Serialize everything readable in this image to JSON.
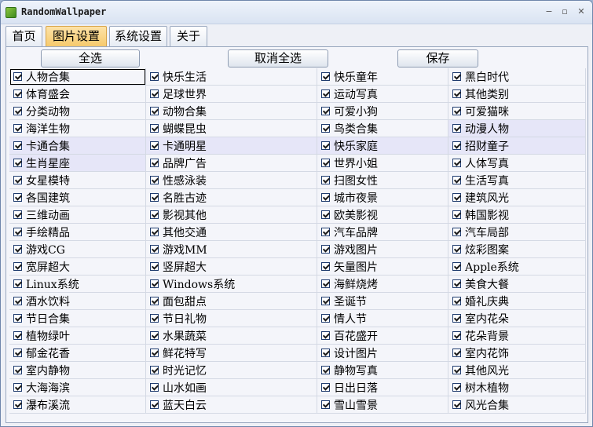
{
  "window": {
    "title": "RandomWallpaper"
  },
  "title_controls": {
    "minimize": "−",
    "maximize": "▫",
    "close": "✕"
  },
  "tabs": [
    {
      "label": "首页"
    },
    {
      "label": "图片设置"
    },
    {
      "label": "系统设置"
    },
    {
      "label": "关于"
    }
  ],
  "toolbar": {
    "select_all": "全选",
    "deselect_all": "取消全选",
    "save": "保存"
  },
  "categories": [
    [
      "人物合集",
      "快乐生活",
      "快乐童年",
      "黑白时代"
    ],
    [
      "体育盛会",
      "足球世界",
      "运动写真",
      "其他类别"
    ],
    [
      "分类动物",
      "动物合集",
      "可爱小狗",
      "可爱猫咪"
    ],
    [
      "海洋生物",
      "蝴蝶昆虫",
      "鸟类合集",
      "动漫人物"
    ],
    [
      "卡通合集",
      "卡通明星",
      "快乐家庭",
      "招财童子"
    ],
    [
      "生肖星座",
      "品牌广告",
      "世界小姐",
      "人体写真"
    ],
    [
      "女星模特",
      "性感泳装",
      "扫图女性",
      "生活写真"
    ],
    [
      "各国建筑",
      "名胜古迹",
      "城市夜景",
      "建筑风光"
    ],
    [
      "三维动画",
      "影视其他",
      "欧美影视",
      "韩国影视"
    ],
    [
      "手绘精品",
      "其他交通",
      "汽车品牌",
      "汽车局部"
    ],
    [
      "游戏CG",
      "游戏MM",
      "游戏图片",
      "炫彩图案"
    ],
    [
      "宽屏超大",
      "竖屏超大",
      "矢量图片",
      "Apple系统"
    ],
    [
      "Linux系统",
      "Windows系统",
      "海鲜烧烤",
      "美食大餐"
    ],
    [
      "酒水饮料",
      "面包甜点",
      "圣诞节",
      "婚礼庆典"
    ],
    [
      "节日合集",
      "节日礼物",
      "情人节",
      "室内花朵"
    ],
    [
      "植物绿叶",
      "水果蔬菜",
      "百花盛开",
      "花朵背景"
    ],
    [
      "郁金花香",
      "鲜花特写",
      "设计图片",
      "室内花饰"
    ],
    [
      "室内静物",
      "时光记忆",
      "静物写真",
      "其他风光"
    ],
    [
      "大海海滨",
      "山水如画",
      "日出日落",
      "树木植物"
    ],
    [
      "瀑布溪流",
      "蓝天白云",
      "雪山雪景",
      "风光合集"
    ]
  ],
  "all_checked": true,
  "colors": {
    "tab_active": "#f6c96a",
    "row_highlight": "#e6e6f8"
  }
}
